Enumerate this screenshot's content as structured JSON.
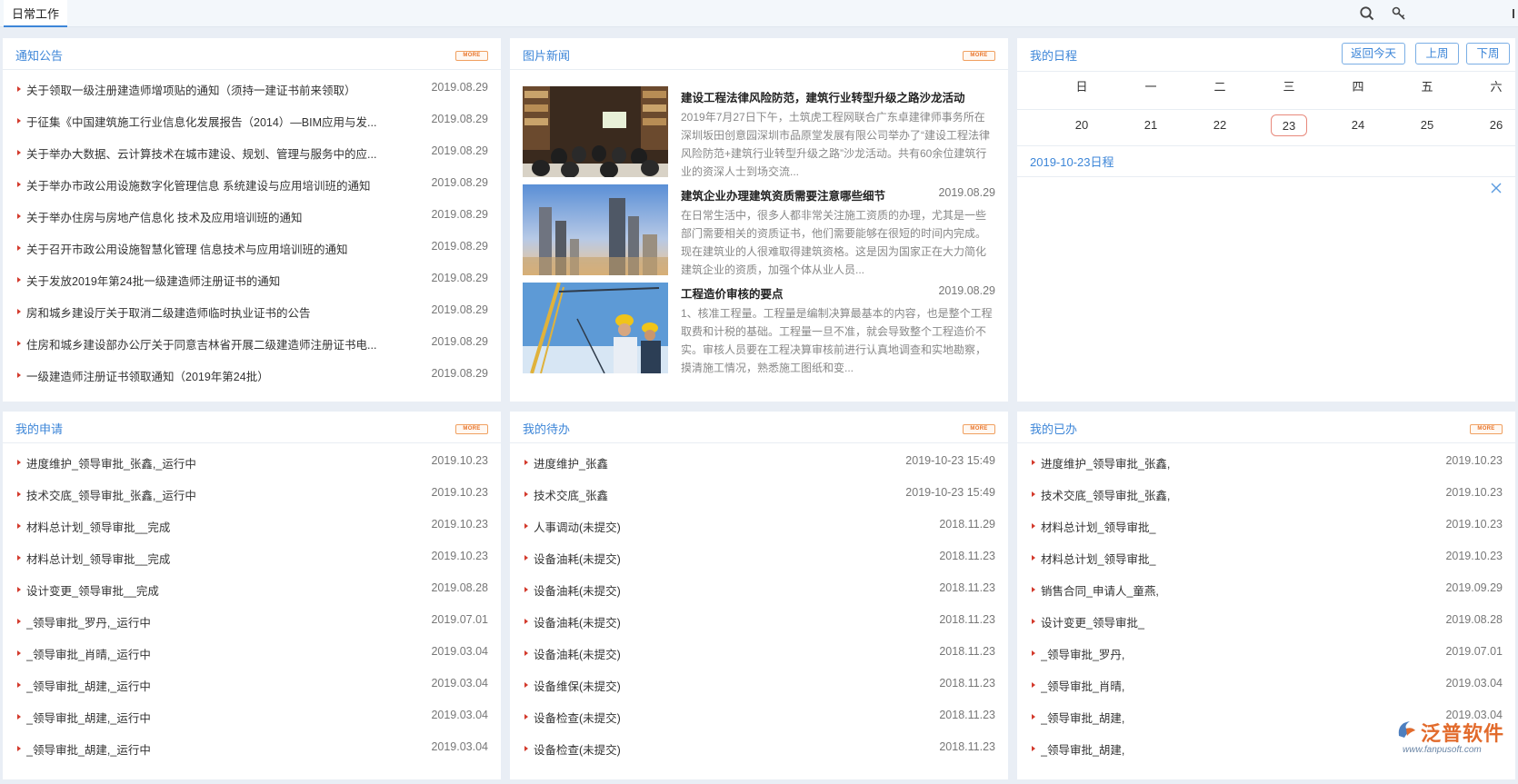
{
  "tab": {
    "label": "日常工作"
  },
  "toolbar": {
    "search_icon": "search-icon",
    "key_icon": "key-icon"
  },
  "colors": {
    "accent": "#3d86d8",
    "bullet": "#d33a2c",
    "more": "#e8742a",
    "today_border": "#e8897c"
  },
  "more_label": "MORE",
  "notices": {
    "title": "通知公告",
    "items": [
      {
        "text": "关于领取一级注册建造师增项贴的通知（须持一建证书前来领取）",
        "date": "2019.08.29"
      },
      {
        "text": "于征集《中国建筑施工行业信息化发展报告（2014）—BIM应用与发...",
        "date": "2019.08.29"
      },
      {
        "text": "关于举办大数据、云计算技术在城市建设、规划、管理与服务中的应...",
        "date": "2019.08.29"
      },
      {
        "text": "关于举办市政公用设施数字化管理信息 系统建设与应用培训班的通知",
        "date": "2019.08.29"
      },
      {
        "text": "关于举办住房与房地产信息化 技术及应用培训班的通知",
        "date": "2019.08.29"
      },
      {
        "text": "关于召开市政公用设施智慧化管理 信息技术与应用培训班的通知",
        "date": "2019.08.29"
      },
      {
        "text": "关于发放2019年第24批一级建造师注册证书的通知",
        "date": "2019.08.29"
      },
      {
        "text": "房和城乡建设厅关于取消二级建造师临时执业证书的公告",
        "date": "2019.08.29"
      },
      {
        "text": "住房和城乡建设部办公厅关于同意吉林省开展二级建造师注册证书电...",
        "date": "2019.08.29"
      },
      {
        "text": "一级建造师注册证书领取通知（2019年第24批）",
        "date": "2019.08.29"
      }
    ]
  },
  "news": {
    "title": "图片新闻",
    "items": [
      {
        "title": "建设工程法律风险防范，建筑行业转型升级之路沙龙活动",
        "date": "",
        "body": "2019年7月27日下午，土筑虎工程网联合广东卓建律师事务所在深圳坂田创意园深圳市品原堂发展有限公司举办了“建设工程法律风险防范+建筑行业转型升级之路”沙龙活动。共有60余位建筑行业的资深人士到场交流..."
      },
      {
        "title": "建筑企业办理建筑资质需要注意哪些细节",
        "date": "2019.08.29",
        "body": "在日常生活中，很多人都非常关注施工资质的办理，尤其是一些部门需要相关的资质证书，他们需要能够在很短的时间内完成。现在建筑业的人很难取得建筑资格。这是因为国家正在大力简化建筑企业的资质，加强个体从业人员..."
      },
      {
        "title": "工程造价审核的要点",
        "date": "2019.08.29",
        "body": "1、核准工程量。工程量是编制决算最基本的内容，也是整个工程取费和计税的基础。工程量一旦不准，就会导致整个工程造价不实。审核人员要在工程决算审核前进行认真地调查和实地勘察，摸清施工情况，熟悉施工图纸和变..."
      }
    ]
  },
  "calendar": {
    "title": "我的日程",
    "buttons": {
      "today": "返回今天",
      "prev": "上周",
      "next": "下周"
    },
    "weekdays": [
      "日",
      "一",
      "二",
      "三",
      "四",
      "五",
      "六"
    ],
    "days": [
      "20",
      "21",
      "22",
      "23",
      "24",
      "25",
      "26"
    ],
    "today_index": 3,
    "schedule_label": "2019-10-23日程"
  },
  "my_applications": {
    "title": "我的申请",
    "items": [
      {
        "text": "进度维护_领导审批_张鑫,_运行中",
        "date": "2019.10.23"
      },
      {
        "text": "技术交底_领导审批_张鑫,_运行中",
        "date": "2019.10.23"
      },
      {
        "text": "材料总计划_领导审批__完成",
        "date": "2019.10.23"
      },
      {
        "text": "材料总计划_领导审批__完成",
        "date": "2019.10.23"
      },
      {
        "text": "设计变更_领导审批__完成",
        "date": "2019.08.28"
      },
      {
        "text": "_领导审批_罗丹,_运行中",
        "date": "2019.07.01"
      },
      {
        "text": "_领导审批_肖晴,_运行中",
        "date": "2019.03.04"
      },
      {
        "text": "_领导审批_胡建,_运行中",
        "date": "2019.03.04"
      },
      {
        "text": "_领导审批_胡建,_运行中",
        "date": "2019.03.04"
      },
      {
        "text": "_领导审批_胡建,_运行中",
        "date": "2019.03.04"
      }
    ]
  },
  "my_todo": {
    "title": "我的待办",
    "items": [
      {
        "text": "进度维护_张鑫",
        "date": "2019-10-23 15:49"
      },
      {
        "text": "技术交底_张鑫",
        "date": "2019-10-23 15:49"
      },
      {
        "text": "人事调动(未提交)",
        "date": "2018.11.29"
      },
      {
        "text": "设备油耗(未提交)",
        "date": "2018.11.23"
      },
      {
        "text": "设备油耗(未提交)",
        "date": "2018.11.23"
      },
      {
        "text": "设备油耗(未提交)",
        "date": "2018.11.23"
      },
      {
        "text": "设备油耗(未提交)",
        "date": "2018.11.23"
      },
      {
        "text": "设备维保(未提交)",
        "date": "2018.11.23"
      },
      {
        "text": "设备检查(未提交)",
        "date": "2018.11.23"
      },
      {
        "text": "设备检查(未提交)",
        "date": "2018.11.23"
      }
    ]
  },
  "my_done": {
    "title": "我的已办",
    "items": [
      {
        "text": "进度维护_领导审批_张鑫,",
        "date": "2019.10.23"
      },
      {
        "text": "技术交底_领导审批_张鑫,",
        "date": "2019.10.23"
      },
      {
        "text": "材料总计划_领导审批_",
        "date": "2019.10.23"
      },
      {
        "text": "材料总计划_领导审批_",
        "date": "2019.10.23"
      },
      {
        "text": "销售合同_申请人_童燕,",
        "date": "2019.09.29"
      },
      {
        "text": "设计变更_领导审批_",
        "date": "2019.08.28"
      },
      {
        "text": "_领导审批_罗丹,",
        "date": "2019.07.01"
      },
      {
        "text": "_领导审批_肖晴,",
        "date": "2019.03.04"
      },
      {
        "text": "_领导审批_胡建,",
        "date": "2019.03.04"
      },
      {
        "text": "_领导审批_胡建,",
        "date": ""
      }
    ]
  },
  "watermark": {
    "brand": "泛普软件",
    "url": "www.fanpusoft.com"
  }
}
